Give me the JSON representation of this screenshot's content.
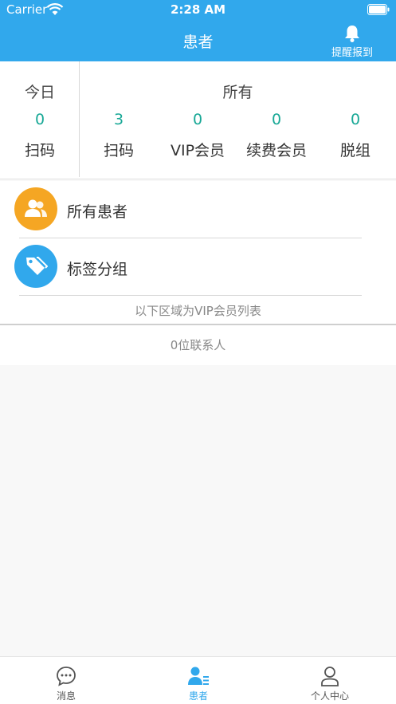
{
  "status_bar": {
    "carrier": "Carrier",
    "time": "2:28 AM"
  },
  "nav": {
    "title": "患者",
    "remind_label": "提醒报到"
  },
  "stats": {
    "today": {
      "title": "今日",
      "scan": {
        "value": "0",
        "label": "扫码"
      }
    },
    "all": {
      "title": "所有",
      "items": [
        {
          "value": "3",
          "label": "扫码"
        },
        {
          "value": "0",
          "label": "VIP会员"
        },
        {
          "value": "0",
          "label": "续费会员"
        },
        {
          "value": "0",
          "label": "脱组"
        }
      ]
    }
  },
  "list": {
    "items": [
      {
        "label": "所有患者",
        "icon": "users-icon",
        "color": "#f5a623"
      },
      {
        "label": "标签分组",
        "icon": "tags-icon",
        "color": "#31a8ec"
      }
    ],
    "vip_caption": "以下区域为VIP会员列表",
    "contacts_count": "0位联系人"
  },
  "tabbar": {
    "tabs": [
      {
        "label": "消息",
        "icon": "message-icon"
      },
      {
        "label": "患者",
        "icon": "patients-icon",
        "active": true
      },
      {
        "label": "个人中心",
        "icon": "profile-icon"
      }
    ]
  },
  "colors": {
    "primary": "#31a8ec",
    "accent_green": "#18a896",
    "orange": "#f5a623"
  }
}
